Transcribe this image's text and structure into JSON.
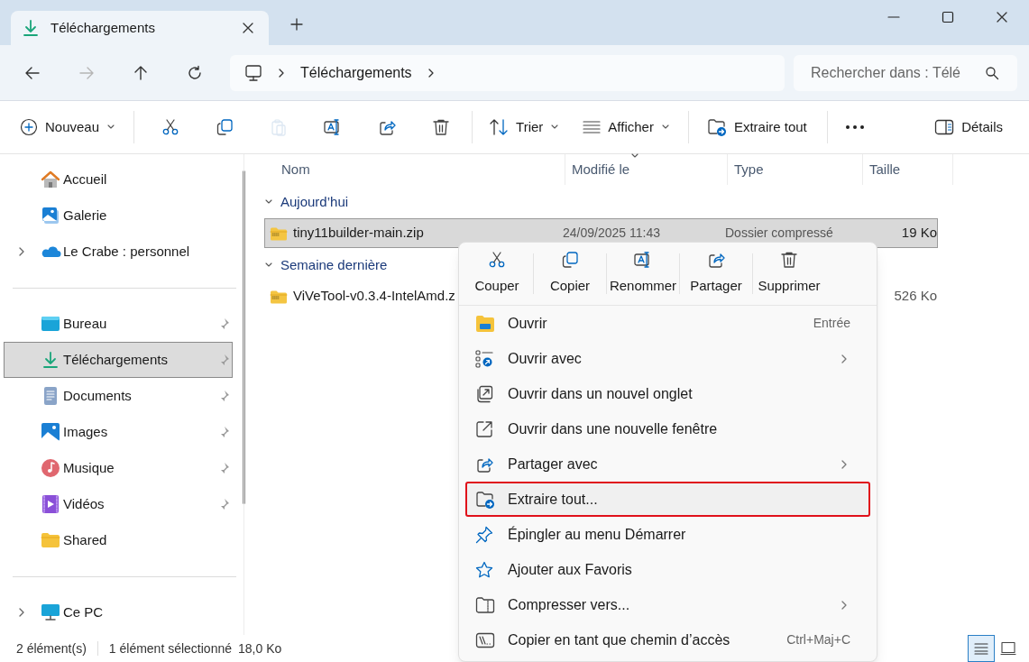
{
  "tab": {
    "title": "Téléchargements"
  },
  "address": {
    "crumbs": [
      "Téléchargements"
    ]
  },
  "search": {
    "placeholder": "Rechercher dans : Télé"
  },
  "toolbar": {
    "new": "Nouveau",
    "sort": "Trier",
    "view": "Afficher",
    "extract": "Extraire tout",
    "details": "Détails",
    "icon_buttons": [
      {
        "disabled": false
      },
      {
        "disabled": false
      },
      {
        "disabled": true
      },
      {
        "disabled": false
      },
      {
        "disabled": false
      },
      {
        "disabled": false
      }
    ]
  },
  "sidebar": {
    "groups": [
      {
        "items": [
          {
            "label": "Accueil",
            "expandable": false,
            "pinned": false,
            "selected": false
          },
          {
            "label": "Galerie",
            "expandable": false,
            "pinned": false,
            "selected": false
          },
          {
            "label": "Le Crabe : personnel",
            "expandable": true,
            "pinned": false,
            "selected": false
          }
        ]
      },
      {
        "items": [
          {
            "label": "Bureau",
            "expandable": false,
            "pinned": true,
            "selected": false
          },
          {
            "label": "Téléchargements",
            "expandable": false,
            "pinned": true,
            "selected": true
          },
          {
            "label": "Documents",
            "expandable": false,
            "pinned": true,
            "selected": false
          },
          {
            "label": "Images",
            "expandable": false,
            "pinned": true,
            "selected": false
          },
          {
            "label": "Musique",
            "expandable": false,
            "pinned": true,
            "selected": false
          },
          {
            "label": "Vidéos",
            "expandable": false,
            "pinned": true,
            "selected": false
          },
          {
            "label": "Shared",
            "expandable": false,
            "pinned": false,
            "selected": false
          }
        ]
      },
      {
        "items": [
          {
            "label": "Ce PC",
            "expandable": true,
            "pinned": false,
            "selected": false
          }
        ]
      }
    ]
  },
  "files": {
    "columns": [
      "Nom",
      "Modifié le",
      "Type",
      "Taille"
    ],
    "groups": [
      {
        "label": "Aujourd’hui",
        "expanded": true,
        "rows": [
          {
            "name": "tiny11builder-main.zip",
            "modified": "24/09/2025 11:43",
            "type": "Dossier compressé",
            "size": "19 Ko",
            "selected": true
          }
        ]
      },
      {
        "label": "Semaine dernière",
        "expanded": true,
        "rows": [
          {
            "name": "ViVeTool-v0.3.4-IntelAmd.z",
            "size": "526 Ko",
            "selected": false
          }
        ]
      }
    ]
  },
  "context_menu": {
    "actions": [
      {
        "label": "Couper"
      },
      {
        "label": "Copier"
      },
      {
        "label": "Renommer"
      },
      {
        "label": "Partager"
      },
      {
        "label": "Supprimer"
      }
    ],
    "items": [
      {
        "label": "Ouvrir",
        "shortcut": "Entrée",
        "submenu": false,
        "highlighted": false
      },
      {
        "label": "Ouvrir avec",
        "submenu": true,
        "highlighted": false
      },
      {
        "label": "Ouvrir dans un nouvel onglet",
        "submenu": false,
        "highlighted": false
      },
      {
        "label": "Ouvrir dans une nouvelle fenêtre",
        "submenu": false,
        "highlighted": false
      },
      {
        "label": "Partager avec",
        "submenu": true,
        "highlighted": false
      },
      {
        "label": "Extraire tout...",
        "submenu": false,
        "highlighted": true
      },
      {
        "label": "Épingler au menu Démarrer",
        "submenu": false,
        "highlighted": false
      },
      {
        "label": "Ajouter aux Favoris",
        "submenu": false,
        "highlighted": false
      },
      {
        "label": "Compresser vers...",
        "submenu": true,
        "highlighted": false
      },
      {
        "label": "Copier en tant que chemin d’accès",
        "shortcut": "Ctrl+Maj+C",
        "submenu": false,
        "highlighted": false
      }
    ]
  },
  "status_bar": {
    "count": "2 élément(s)",
    "selection": "1 élément sélectionné",
    "size": "18,0 Ko",
    "view_buttons": [
      {
        "selected": true
      },
      {
        "selected": false
      }
    ]
  }
}
